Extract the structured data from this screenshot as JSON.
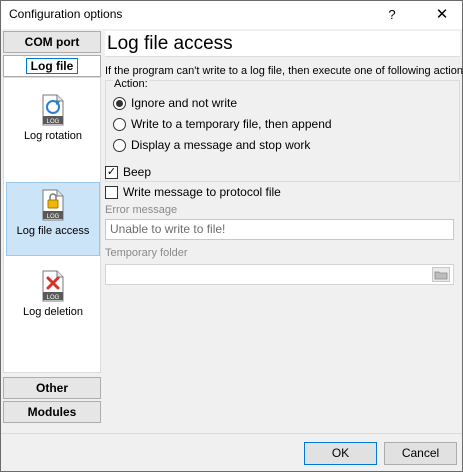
{
  "window": {
    "title": "Configuration options",
    "help_glyph": "?",
    "close_glyph": "✕"
  },
  "sidebar": {
    "top_buttons": [
      {
        "label": "COM port"
      },
      {
        "label": "Log file"
      }
    ],
    "items": [
      {
        "label": "Log rotation",
        "icon": "log-rotation-icon"
      },
      {
        "label": "Log file access",
        "icon": "log-file-access-icon",
        "selected": true
      },
      {
        "label": "Log deletion",
        "icon": "log-deletion-icon"
      }
    ],
    "bottom_buttons": [
      {
        "label": "Other"
      },
      {
        "label": "Modules"
      }
    ],
    "icon_badge": "LOG"
  },
  "content": {
    "heading": "Log file access",
    "description": "If the program can't write to a log file, then execute one of following actions:",
    "action_label": "Action:",
    "actions": [
      {
        "label": "Ignore and not write",
        "selected": true
      },
      {
        "label": "Write to a temporary file, then append",
        "selected": false
      },
      {
        "label": "Display a message and stop work",
        "selected": false
      }
    ],
    "beep": {
      "label": "Beep",
      "checked": true,
      "mark": "✓"
    },
    "write_protocol": {
      "label": "Write message to protocol file",
      "checked": false
    },
    "error_message": {
      "label": "Error message",
      "value": "Unable to write to file!"
    },
    "temp_folder": {
      "label": "Temporary folder",
      "value": ""
    }
  },
  "footer": {
    "ok_label": "OK",
    "cancel_label": "Cancel"
  },
  "colors": {
    "selection_bg": "#cce4f7",
    "selection_border": "#99c9ef",
    "focus_accent": "#0078d7"
  }
}
